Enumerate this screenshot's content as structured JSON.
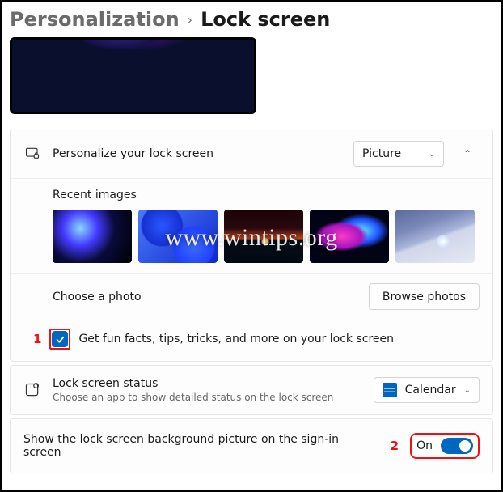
{
  "breadcrumb": {
    "parent": "Personalization",
    "current": "Lock screen"
  },
  "personalize": {
    "title": "Personalize your lock screen",
    "dropdown_value": "Picture",
    "recent_label": "Recent images",
    "choose_label": "Choose a photo",
    "browse_label": "Browse photos",
    "fun_facts_label": "Get fun facts, tips, tricks, and more on your lock screen",
    "fun_facts_checked": true
  },
  "status": {
    "title": "Lock screen status",
    "subtitle": "Choose an app to show detailed status on the lock screen",
    "app_value": "Calendar"
  },
  "signin": {
    "label": "Show the lock screen background picture on the sign-in screen",
    "toggle_label": "On",
    "toggle_on": true
  },
  "callouts": {
    "one": "1",
    "two": "2"
  },
  "watermark": "www.wintips.org"
}
